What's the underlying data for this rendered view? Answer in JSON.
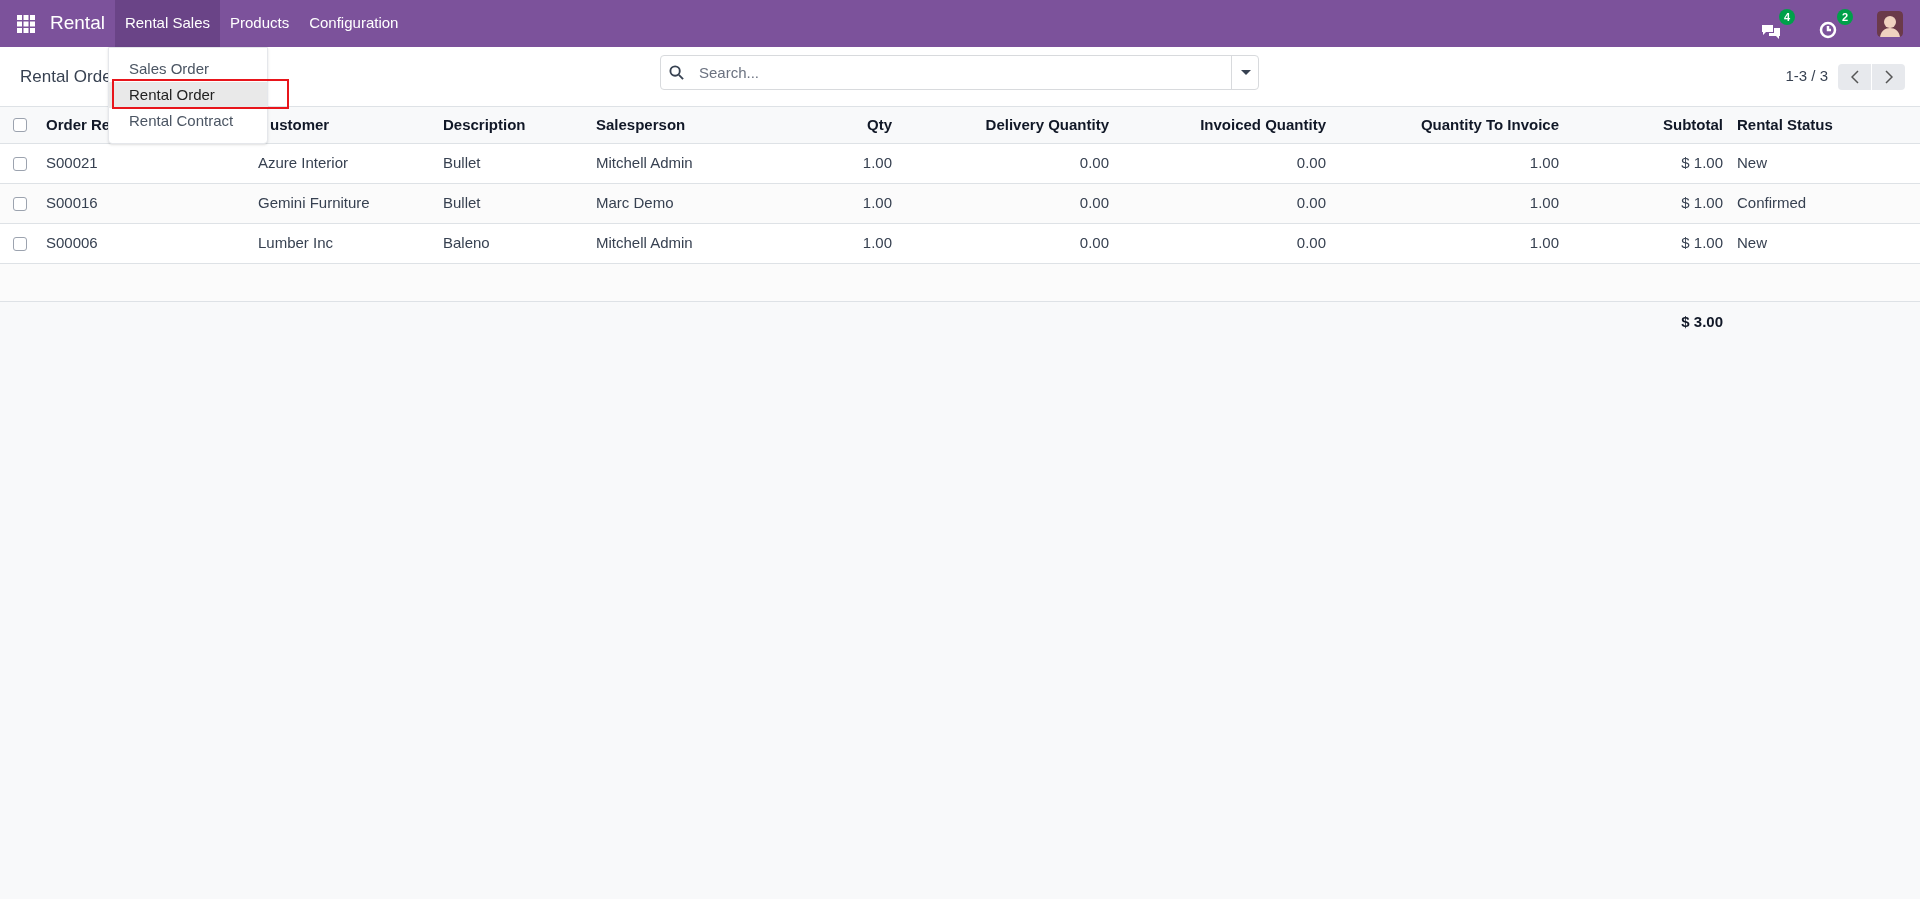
{
  "navbar": {
    "app_name": "Rental",
    "menus": [
      {
        "label": "Rental Sales",
        "selected": true
      },
      {
        "label": "Products",
        "selected": false
      },
      {
        "label": "Configuration",
        "selected": false
      }
    ],
    "messages_badge": "4",
    "activities_badge": "2"
  },
  "dropdown": {
    "items": [
      {
        "label": "Sales Order",
        "selected": false
      },
      {
        "label": "Rental Order",
        "selected": true
      },
      {
        "label": "Rental Contract",
        "selected": false
      }
    ]
  },
  "control_panel": {
    "title": "Rental Orde",
    "search": {
      "placeholder": "Search..."
    },
    "pager": "1-3 / 3"
  },
  "table": {
    "header_checked": false,
    "columns": [
      {
        "label": "Order Re",
        "kind": "text"
      },
      {
        "label": "ustomer",
        "kind": "text"
      },
      {
        "label": "Description",
        "kind": "text"
      },
      {
        "label": "Salesperson",
        "kind": "text"
      },
      {
        "label": "Qty",
        "kind": "number"
      },
      {
        "label": "Delivery Quantity",
        "kind": "number"
      },
      {
        "label": "Invoiced Quantity",
        "kind": "number"
      },
      {
        "label": "Quantity To Invoice",
        "kind": "number"
      },
      {
        "label": "Subtotal",
        "kind": "number"
      },
      {
        "label": "Rental Status",
        "kind": "text"
      }
    ],
    "rows": [
      {
        "checked": false,
        "cells": [
          "S00021",
          "Azure Interior",
          "Bullet",
          "Mitchell Admin",
          "1.00",
          "0.00",
          "0.00",
          "1.00",
          "$ 1.00",
          "New"
        ]
      },
      {
        "checked": false,
        "cells": [
          "S00016",
          "Gemini Furniture",
          "Bullet",
          "Marc Demo",
          "1.00",
          "0.00",
          "0.00",
          "1.00",
          "$ 1.00",
          "Confirmed"
        ]
      },
      {
        "checked": false,
        "cells": [
          "S00006",
          "Lumber Inc",
          "Baleno",
          "Mitchell Admin",
          "1.00",
          "0.00",
          "0.00",
          "1.00",
          "$ 1.00",
          "New"
        ]
      }
    ],
    "total_subtotal": "$ 3.00"
  }
}
